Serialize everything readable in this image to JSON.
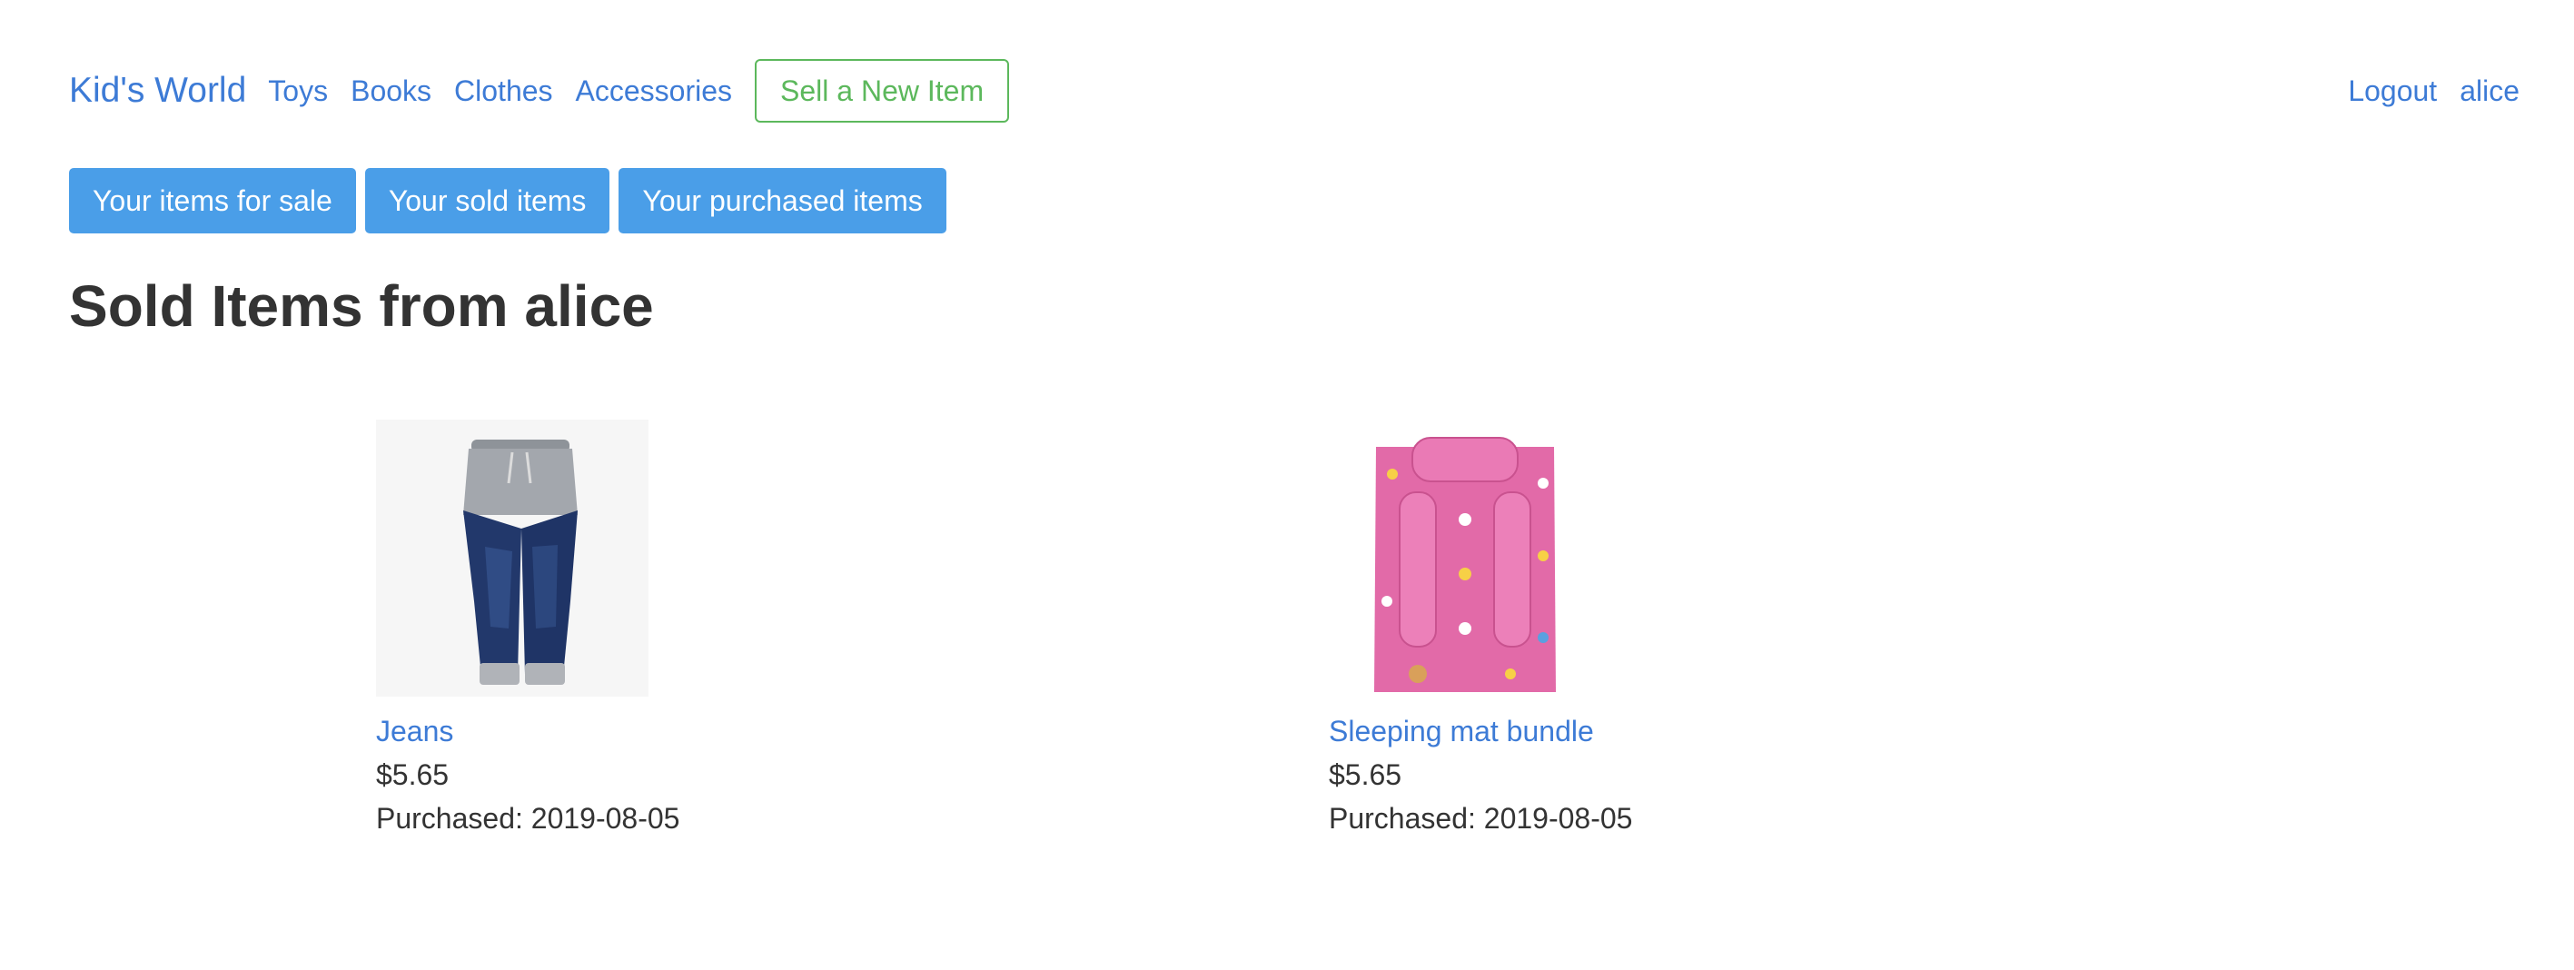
{
  "navbar": {
    "brand": "Kid's World",
    "links": [
      "Toys",
      "Books",
      "Clothes",
      "Accessories"
    ],
    "sell_button": "Sell a New Item",
    "logout": "Logout",
    "username": "alice"
  },
  "actions": {
    "for_sale": "Your items for sale",
    "sold": "Your sold items",
    "purchased": "Your purchased items"
  },
  "page_title": "Sold Items from alice",
  "items": [
    {
      "name": "Jeans",
      "price": "$5.65",
      "purchased": "Purchased: 2019-08-05",
      "image": "jeans-photo"
    },
    {
      "name": "Sleeping mat bundle",
      "price": "$5.65",
      "purchased": "Purchased: 2019-08-05",
      "image": "sleeping-mat-photo"
    }
  ],
  "colors": {
    "link": "#3d7bd6",
    "primary_button": "#4a9ee8",
    "success": "#5cb85c",
    "text": "#333333"
  }
}
